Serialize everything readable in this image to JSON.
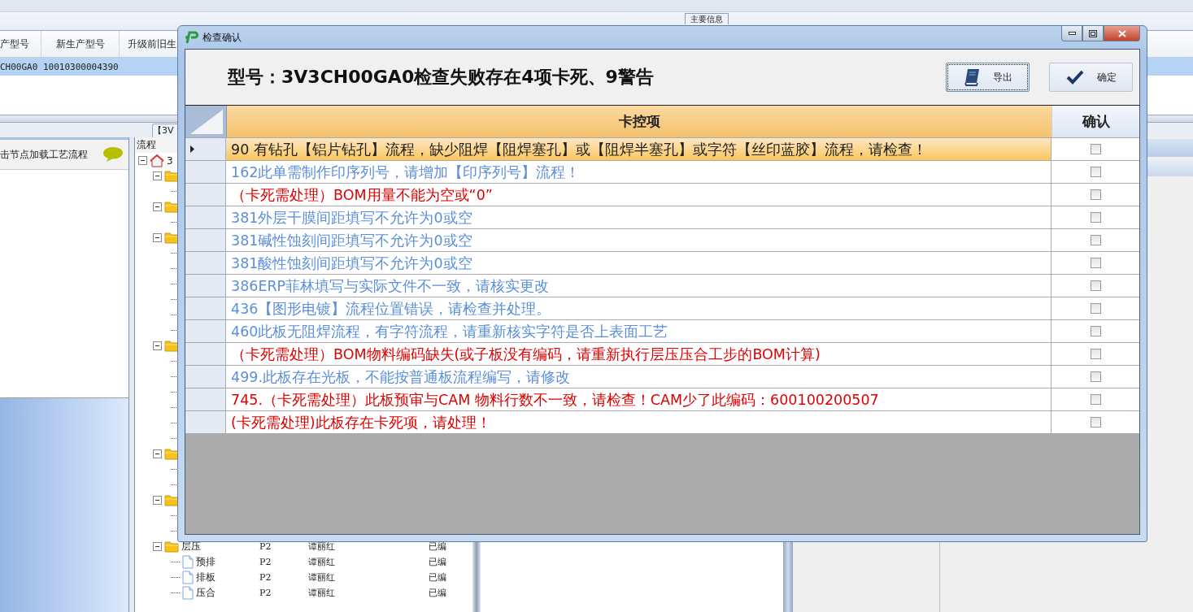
{
  "main_info": {
    "group_label": "主要信息",
    "columns": [
      "产型号",
      "新生产型号",
      "升级前旧生"
    ],
    "rows": [
      {
        "cells": [
          "CH00GA0",
          "10010300004390"
        ],
        "selected": true
      }
    ]
  },
  "tab": {
    "label": "【3V"
  },
  "left_panel": {
    "hint": "击节点加载工艺流程"
  },
  "flow_tree": {
    "header": "流程",
    "root": {
      "kind": "root",
      "label": "3",
      "expanded": true,
      "children": [
        {
          "kind": "folder",
          "expanded": true,
          "children": [
            {
              "kind": "file"
            }
          ]
        },
        {
          "kind": "folder",
          "expanded": true,
          "children": [
            {
              "kind": "file"
            }
          ]
        },
        {
          "kind": "folder",
          "expanded": true,
          "children": [
            {
              "kind": "file"
            },
            {
              "kind": "file"
            },
            {
              "kind": "file"
            },
            {
              "kind": "file"
            },
            {
              "kind": "file"
            },
            {
              "kind": "file"
            }
          ]
        },
        {
          "kind": "folder",
          "expanded": true,
          "children": [
            {
              "kind": "file"
            },
            {
              "kind": "file"
            },
            {
              "kind": "file"
            },
            {
              "kind": "file"
            },
            {
              "kind": "file"
            },
            {
              "kind": "file"
            }
          ]
        },
        {
          "kind": "folder",
          "expanded": true,
          "children": [
            {
              "kind": "file"
            },
            {
              "kind": "file"
            }
          ]
        },
        {
          "kind": "folder",
          "expanded": true,
          "children": [
            {
              "kind": "file"
            },
            {
              "kind": "file"
            }
          ]
        },
        {
          "kind": "folder",
          "label": "层压",
          "cells": [
            "P2",
            "谭丽红",
            "已编"
          ],
          "expanded": true,
          "children": [
            {
              "kind": "file",
              "label": "预排",
              "cells": [
                "P2",
                "谭丽红",
                "已编"
              ]
            },
            {
              "kind": "file",
              "label": "排板",
              "cells": [
                "P2",
                "谭丽红",
                "已编"
              ]
            },
            {
              "kind": "file",
              "label": "压合",
              "cells": [
                "P2",
                "谭丽红",
                "已编"
              ]
            }
          ]
        }
      ]
    }
  },
  "dialog": {
    "title": "检查确认",
    "heading": "型号：3V3CH00GA0检查失败存在4项卡死、9警告",
    "buttons": [
      {
        "kind": "export",
        "label": "导出",
        "focused": true
      },
      {
        "kind": "confirm",
        "label": "确定",
        "focused": false
      }
    ],
    "columns": [
      "卡控项",
      "确认"
    ],
    "rows": [
      {
        "text": "90 有钻孔【铝片钻孔】流程，缺少阻焊【阻焊塞孔】或【阻焊半塞孔】或字符【丝印蓝胶】流程，请检查！",
        "selected": true,
        "checked": false
      },
      {
        "text": "162此单需制作印序列号，请增加【印序列号】流程！",
        "color": "#5b8fd9",
        "selected": false,
        "checked": false
      },
      {
        "text": "（卡死需处理）BOM用量不能为空或“0”",
        "color": "#e00000",
        "selected": false,
        "checked": false
      },
      {
        "text": "381外层干膜间距填写不允许为0或空",
        "color": "#5b8fd9",
        "selected": false,
        "checked": false
      },
      {
        "text": "381碱性蚀刻间距填写不允许为0或空",
        "color": "#5b8fd9",
        "selected": false,
        "checked": false
      },
      {
        "text": "381酸性蚀刻间距填写不允许为0或空",
        "color": "#5b8fd9",
        "selected": false,
        "checked": false
      },
      {
        "text": "386ERP菲林填写与实际文件不一致，请核实更改",
        "color": "#5b8fd9",
        "selected": false,
        "checked": false
      },
      {
        "text": "436【图形电镀】流程位置错误，请检查并处理。",
        "color": "#5b8fd9",
        "selected": false,
        "checked": false
      },
      {
        "text": "460此板无阻焊流程，有字符流程，请重新核实字符是否上表面工艺",
        "color": "#5b8fd9",
        "selected": false,
        "checked": false
      },
      {
        "text": "（卡死需处理）BOM物料编码缺失(或子板没有编码，请重新执行层压压合工步的BOM计算)",
        "color": "#e00000",
        "selected": false,
        "checked": false
      },
      {
        "text": "499.此板存在光板，不能按普通板流程编写，请修改",
        "color": "#5b8fd9",
        "selected": false,
        "checked": false
      },
      {
        "text": "745.（卡死需处理）此板预审与CAM 物料行数不一致，请检查！CAM少了此编码：600100200507",
        "color": "#e00000",
        "selected": false,
        "checked": false
      },
      {
        "text": "(卡死需处理)此板存在卡死项，请处理！",
        "color": "#e00000",
        "selected": false,
        "checked": false
      }
    ]
  }
}
